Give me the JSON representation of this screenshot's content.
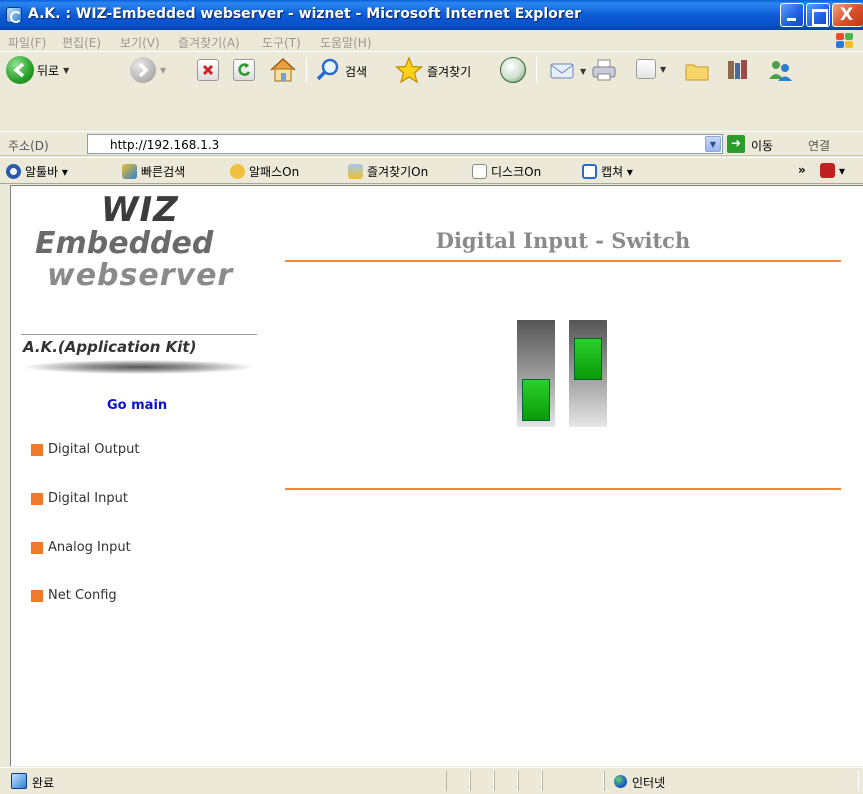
{
  "window": {
    "title": "A.K. : WIZ-Embedded webserver - wiznet - Microsoft Internet Explorer",
    "close_glyph": "X"
  },
  "menu": {
    "items": [
      "파일(F)",
      "편집(E)",
      "보기(V)",
      "즐겨찾기(A)",
      "도구(T)",
      "도움말(H)"
    ]
  },
  "toolbar": {
    "back_label": "뒤로",
    "search_label": "검색",
    "favorites_label": "즐겨찾기"
  },
  "address": {
    "label": "주소(D)",
    "url": "http://192.168.1.3",
    "go_label": "이동",
    "links_label": "연결"
  },
  "linkbar": {
    "items": [
      "알툴바 ▾",
      "빠른검색",
      "알패스On",
      "즐겨찾기On",
      "디스크On",
      "캡쳐 ▾"
    ],
    "overflow": "»"
  },
  "sidebar": {
    "logo_line1": "WIZ",
    "logo_line2": "Embedded",
    "logo_line3": "webserver",
    "logo_line4": "A.K.(Application Kit)",
    "go_main": "Go main",
    "nav": [
      {
        "label": "Digital Output"
      },
      {
        "label": "Digital Input"
      },
      {
        "label": "Analog Input"
      },
      {
        "label": "Net Config"
      }
    ]
  },
  "main": {
    "title": "Digital Input - Switch",
    "switches": [
      {
        "state": "off"
      },
      {
        "state": "on"
      }
    ]
  },
  "status": {
    "text": "완료",
    "zone": "인터넷"
  },
  "colors": {
    "accent_orange": "#f0883a",
    "nav_bullet": "#f07a2a",
    "go_main_link": "#0a10d8",
    "switch_knob": "#1ab81a"
  }
}
